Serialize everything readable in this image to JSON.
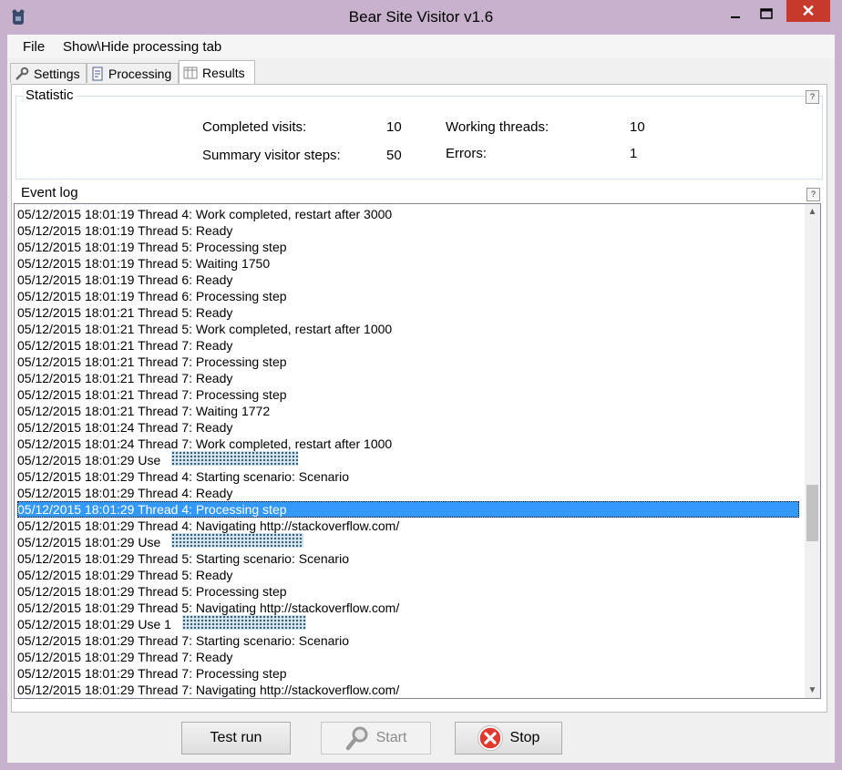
{
  "window": {
    "title": "Bear Site Visitor v1.6",
    "minimize_glyph": "—",
    "maximize_glyph": "☐",
    "close_glyph": "✕",
    "colors": {
      "frame": "#c7b1cc",
      "close": "#c7392b",
      "selection": "#3399ff"
    }
  },
  "menu": {
    "file": "File",
    "toggle_tab": "Show\\Hide processing tab"
  },
  "tabs": {
    "settings": "Settings",
    "processing": "Processing",
    "results": "Results"
  },
  "statistic": {
    "title": "Statistic",
    "help": "?",
    "completed_visits_label": "Completed visits:",
    "completed_visits": "10",
    "summary_steps_label": "Summary visitor steps:",
    "summary_steps": "50",
    "working_threads_label": "Working threads:",
    "working_threads": "10",
    "errors_label": "Errors:",
    "errors": "1"
  },
  "event_log": {
    "title": "Event log",
    "help": "?",
    "lines": [
      "05/12/2015 18:01:19 Thread 4: Work completed, restart after 3000",
      "05/12/2015 18:01:19 Thread 5: Ready",
      "05/12/2015 18:01:19 Thread 5: Processing step",
      "05/12/2015 18:01:19 Thread 5: Waiting 1750",
      "05/12/2015 18:01:19 Thread 6: Ready",
      "05/12/2015 18:01:19 Thread 6: Processing step",
      "05/12/2015 18:01:21 Thread 5: Ready",
      "05/12/2015 18:01:21 Thread 5: Work completed, restart after 1000",
      "05/12/2015 18:01:21 Thread 7: Ready",
      "05/12/2015 18:01:21 Thread 7: Processing step",
      "05/12/2015 18:01:21 Thread 7: Ready",
      "05/12/2015 18:01:21 Thread 7: Processing step",
      "05/12/2015 18:01:21 Thread 7: Waiting 1772",
      "05/12/2015 18:01:24 Thread 7: Ready",
      "05/12/2015 18:01:24 Thread 7: Work completed, restart after 1000",
      "05/12/2015 18:01:29 Use",
      "05/12/2015 18:01:29 Thread 4: Starting scenario: Scenario",
      "05/12/2015 18:01:29 Thread 4: Ready",
      "05/12/2015 18:01:29 Thread 4: Processing step",
      "05/12/2015 18:01:29 Thread 4: Navigating http://stackoverflow.com/",
      "05/12/2015 18:01:29 Use",
      "05/12/2015 18:01:29 Thread 5: Starting scenario: Scenario",
      "05/12/2015 18:01:29 Thread 5: Ready",
      "05/12/2015 18:01:29 Thread 5: Processing step",
      "05/12/2015 18:01:29 Thread 5: Navigating http://stackoverflow.com/",
      "05/12/2015 18:01:29 Use 1",
      "05/12/2015 18:01:29 Thread 7: Starting scenario: Scenario",
      "05/12/2015 18:01:29 Thread 7: Ready",
      "05/12/2015 18:01:29 Thread 7: Processing step",
      "05/12/2015 18:01:29 Thread 7: Navigating http://stackoverflow.com/"
    ],
    "selected_index": 18
  },
  "buttons": {
    "test_run": "Test run",
    "start": "Start",
    "stop": "Stop"
  },
  "scroll": {
    "up": "▲",
    "down": "▼"
  }
}
